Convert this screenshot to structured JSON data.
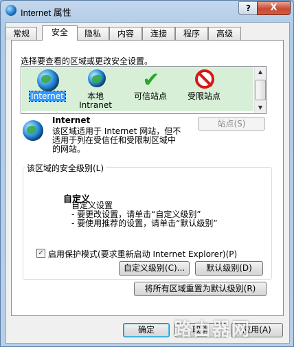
{
  "window": {
    "title": "Internet 属性",
    "help_glyph": "?",
    "close_glyph": "X"
  },
  "tabs": [
    {
      "label": "常规"
    },
    {
      "label": "安全"
    },
    {
      "label": "隐私"
    },
    {
      "label": "内容"
    },
    {
      "label": "连接"
    },
    {
      "label": "程序"
    },
    {
      "label": "高级"
    }
  ],
  "active_tab": "安全",
  "security": {
    "zone_prompt": "选择要查看的区域或更改安全设置。",
    "zones": [
      {
        "label_1": "Internet",
        "label_2": "",
        "icon": "globe-icon",
        "selected": true
      },
      {
        "label_1": "本地",
        "label_2": "Intranet",
        "icon": "intranet-icon",
        "selected": false
      },
      {
        "label_1": "可信站点",
        "label_2": "",
        "icon": "check-icon",
        "selected": false
      },
      {
        "label_1": "受限站点",
        "label_2": "",
        "icon": "restricted-icon",
        "selected": false
      }
    ],
    "zone_name": "Internet",
    "zone_description": "该区域适用于 Internet 网站，但不适用于列在受信任和受限制区域中的网站。",
    "sites_button": "站点(S)",
    "level_group_title": "该区域的安全级别(L)",
    "level_title": "自定义",
    "level_lines": [
      "自定义设置",
      "- 要更改设置，请单击“自定义级别”",
      "- 要使用推荐的设置，请单击“默认级别”"
    ],
    "protected_mode_label": "启用保护模式(要求重新启动 Internet Explorer)(P)",
    "protected_mode_checked": true,
    "custom_level_button": "自定义级别(C)...",
    "default_level_button": "默认级别(D)",
    "reset_all_button": "将所有区域重置为默认级别(R)"
  },
  "footer": {
    "ok": "确定",
    "cancel": "取消",
    "apply": "应用(A)"
  },
  "watermark": "路由器网",
  "colors": {
    "zone_list_bg": "#d7efd7",
    "selection": "#3399ff",
    "close": "#c74a34"
  }
}
